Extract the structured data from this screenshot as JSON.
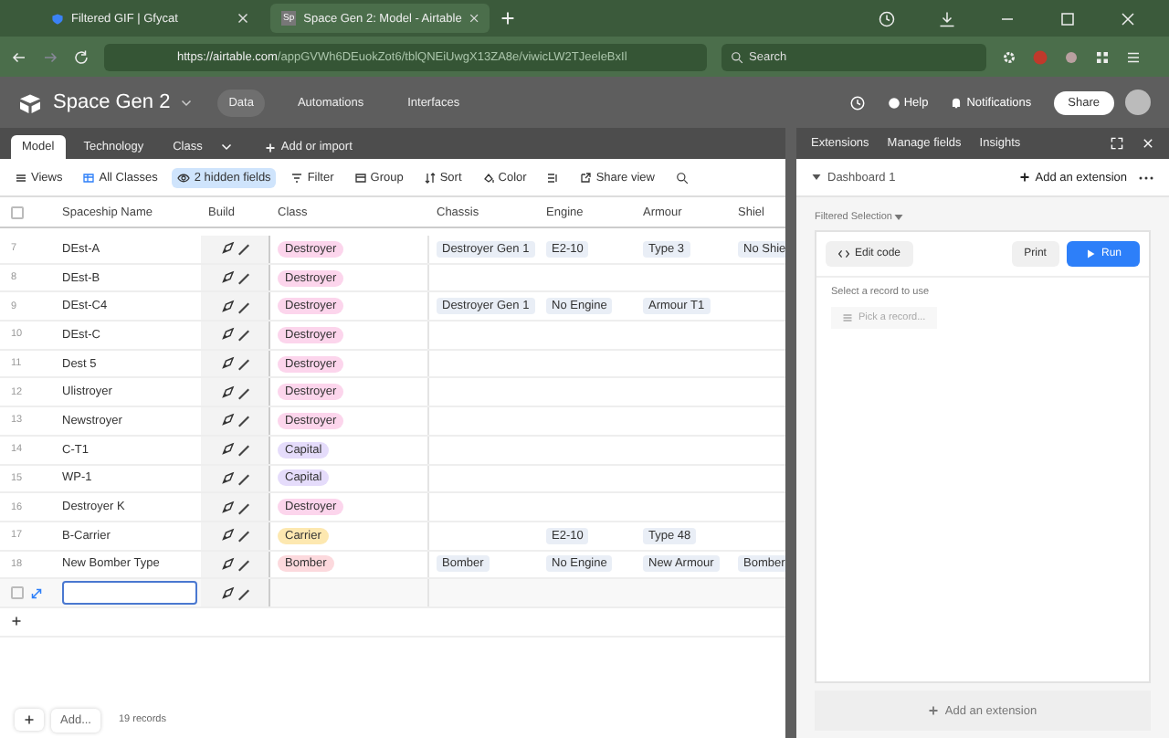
{
  "browser": {
    "tabs": [
      {
        "title": "Filtered GIF | Gfycat",
        "selected": false
      },
      {
        "title": "Space Gen 2: Model - Airtable",
        "favicon": "Sp",
        "selected": true
      }
    ],
    "url_host": "https://airtable.com",
    "url_path": "/appGVWh6DEuokZot6/tblQNEiUwgX13ZA8e/viwicLW2TJeeleBxIl",
    "search_placeholder": "Search"
  },
  "app": {
    "base_name": "Space Gen 2",
    "nav": [
      {
        "label": "Data",
        "selected": true
      },
      {
        "label": "Automations",
        "selected": false
      },
      {
        "label": "Interfaces",
        "selected": false
      }
    ],
    "help": "Help",
    "notifications": "Notifications",
    "share": "Share"
  },
  "table_tabs": [
    {
      "label": "Model",
      "selected": true
    },
    {
      "label": "Technology",
      "selected": false
    },
    {
      "label": "Class",
      "selected": false
    }
  ],
  "add_or_import": "Add or import",
  "toolbar": [
    {
      "kind": "views",
      "label": "Views",
      "active": false
    },
    {
      "kind": "view",
      "label": "All Classes",
      "active": false
    },
    {
      "kind": "hide",
      "label": "2 hidden fields",
      "active": true
    },
    {
      "kind": "filter",
      "label": "Filter",
      "active": false
    },
    {
      "kind": "group",
      "label": "Group",
      "active": false
    },
    {
      "kind": "sort",
      "label": "Sort",
      "active": false
    },
    {
      "kind": "color",
      "label": "Color",
      "active": false
    },
    {
      "kind": "height",
      "active": false
    },
    {
      "kind": "share",
      "label": "Share view",
      "active": false
    }
  ],
  "header_checkbox": {
    "checked": false
  },
  "new_row": {
    "checked": false
  },
  "columns": [
    "Spaceship Name",
    "Build",
    "Class",
    "Chassis",
    "Engine",
    "Armour",
    "Shiel"
  ],
  "rows": [
    {
      "num": "7",
      "name": "DEst-A",
      "class": "Destroyer",
      "color": "#fcd5ec",
      "chassis": "Destroyer Gen 1",
      "engine": "E2-10",
      "armour": "Type 3",
      "shield": "No Shie"
    },
    {
      "num": "8",
      "name": "DEst-B",
      "class": "Destroyer",
      "color": "#fcd5ec"
    },
    {
      "num": "9",
      "name": "DEst-C4",
      "class": "Destroyer",
      "color": "#fcd5ec",
      "chassis": "Destroyer Gen 1",
      "engine": "No Engine",
      "armour": "Armour T1"
    },
    {
      "num": "10",
      "name": "DEst-C",
      "class": "Destroyer",
      "color": "#fcd5ec"
    },
    {
      "num": "11",
      "name": "Dest 5",
      "class": "Destroyer",
      "color": "#fcd5ec"
    },
    {
      "num": "12",
      "name": "Ulistroyer",
      "class": "Destroyer",
      "color": "#fcd5ec"
    },
    {
      "num": "13",
      "name": "Newstroyer",
      "class": "Destroyer",
      "color": "#fcd5ec"
    },
    {
      "num": "14",
      "name": "C-T1",
      "class": "Capital",
      "color": "#e5dcfb"
    },
    {
      "num": "15",
      "name": "WP-1",
      "class": "Capital",
      "color": "#e5dcfb"
    },
    {
      "num": "16",
      "name": "Destroyer K",
      "class": "Destroyer",
      "color": "#fcd5ec"
    },
    {
      "num": "17",
      "name": "B-Carrier",
      "class": "Carrier",
      "color": "#fde8b0",
      "engine": "E2-10",
      "armour": "Type 48"
    },
    {
      "num": "18",
      "name": "New Bomber Type",
      "class": "Bomber",
      "color": "#fcd9dd",
      "chassis": "Bomber",
      "engine": "No Engine",
      "armour": "New Armour",
      "shield": "Bomber"
    }
  ],
  "footer": {
    "add": "Add...",
    "records": "19 records"
  },
  "panel": {
    "tabs": [
      "Extensions",
      "Manage fields",
      "Insights"
    ],
    "dashboard": "Dashboard 1",
    "add_extension": "Add an extension",
    "selection": "Filtered Selection",
    "edit_code": "Edit code",
    "print": "Print",
    "run": "Run",
    "prompt": "Select a record to use",
    "pick": "Pick a record...",
    "bottom_add": "Add an extension"
  }
}
